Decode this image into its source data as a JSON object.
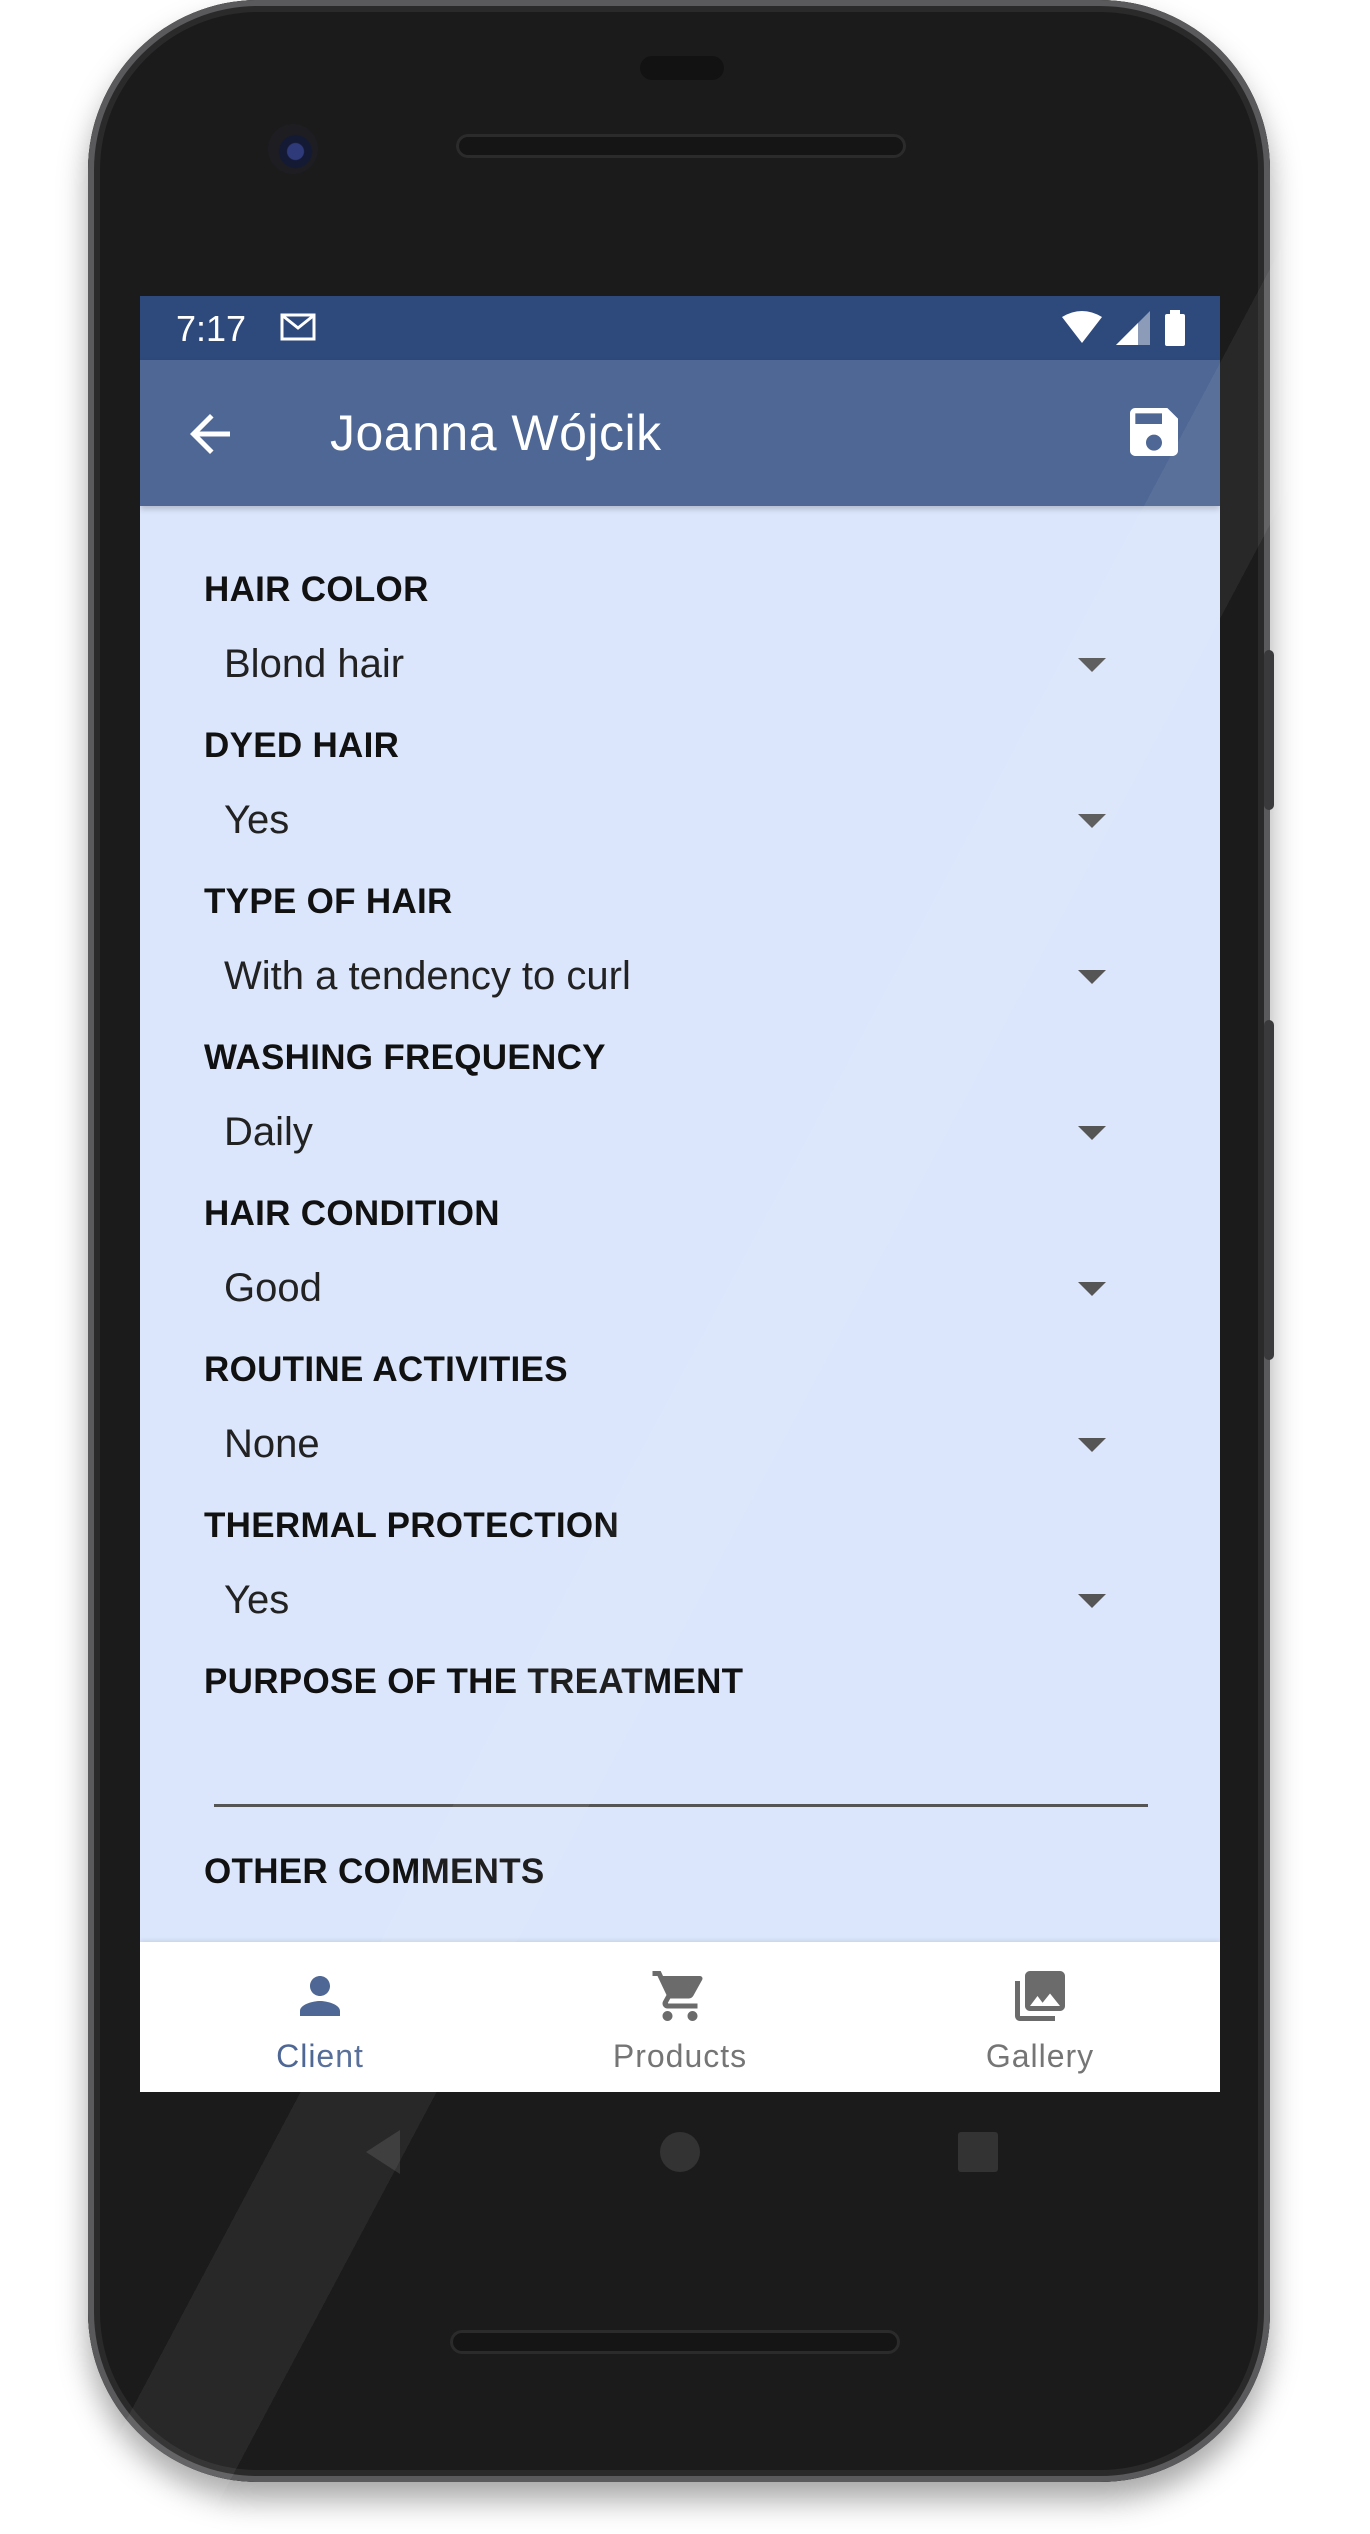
{
  "status_bar": {
    "time": "7:17",
    "icons": [
      "gmail-icon",
      "wifi-icon",
      "signal-icon",
      "battery-icon"
    ]
  },
  "app_bar": {
    "title": "Joanna Wójcik",
    "back_icon": "arrow-back-icon",
    "save_icon": "save-icon"
  },
  "form": {
    "fields": [
      {
        "label": "HAIR COLOR",
        "value": "Blond hair"
      },
      {
        "label": "DYED HAIR",
        "value": "Yes"
      },
      {
        "label": "TYPE OF HAIR",
        "value": "With a tendency to curl"
      },
      {
        "label": "WASHING FREQUENCY",
        "value": "Daily"
      },
      {
        "label": "HAIR CONDITION",
        "value": "Good"
      },
      {
        "label": "ROUTINE ACTIVITIES",
        "value": "None"
      },
      {
        "label": "THERMAL PROTECTION",
        "value": "Yes"
      }
    ],
    "purpose_label": "PURPOSE OF THE TREATMENT",
    "purpose_value": "",
    "comments_label": "OTHER COMMENTS"
  },
  "bottom_nav": {
    "items": [
      {
        "label": "Client",
        "icon": "person-icon",
        "active": true
      },
      {
        "label": "Products",
        "icon": "cart-icon",
        "active": false
      },
      {
        "label": "Gallery",
        "icon": "gallery-icon",
        "active": false
      }
    ]
  },
  "colors": {
    "status_bar": "#2e4a7d",
    "app_bar": "#4e6794",
    "screen_bg": "#dbe6fc",
    "nav_active": "#4e6794",
    "nav_inactive": "#757575"
  }
}
